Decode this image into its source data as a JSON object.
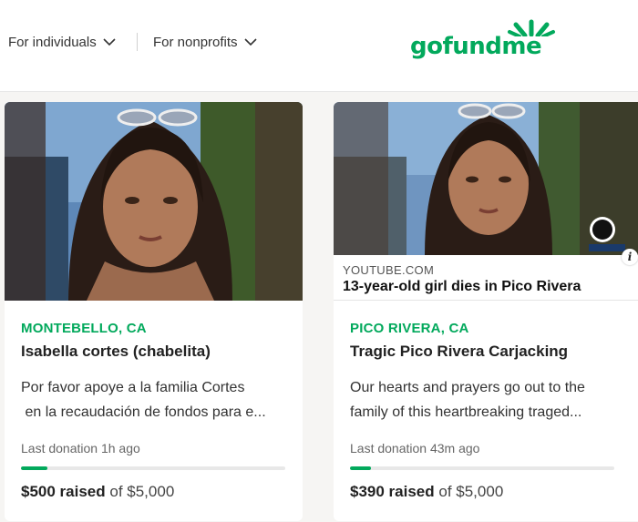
{
  "nav": {
    "individuals": "For individuals",
    "nonprofits": "For nonprofits"
  },
  "logo": {
    "text": "gofundme",
    "color": "#02a95c"
  },
  "cards": [
    {
      "location": "MONTEBELLO, CA",
      "title": "Isabella cortes (chabelita)",
      "description_lines": [
        "Por favor apoye a la familia Cortes",
        " en la recaudación de fondos para e..."
      ],
      "last_donation": "Last donation 1h ago",
      "raised": "$500 raised",
      "goal": "of $5,000",
      "progress_fraction": 0.1
    },
    {
      "link_preview": {
        "domain": "YOUTUBE.COM",
        "title": "13-year-old girl dies in Pico Rivera"
      },
      "location": "PICO RIVERA, CA",
      "title": "Tragic Pico Rivera Carjacking",
      "description_lines": [
        "Our hearts and prayers go out to the",
        "family of this heartbreaking traged..."
      ],
      "last_donation": "Last donation 43m ago",
      "raised": "$390 raised",
      "goal": "of $5,000",
      "progress_fraction": 0.078
    }
  ],
  "colors": {
    "accent": "#02a95c",
    "background": "#f6f5f3"
  }
}
